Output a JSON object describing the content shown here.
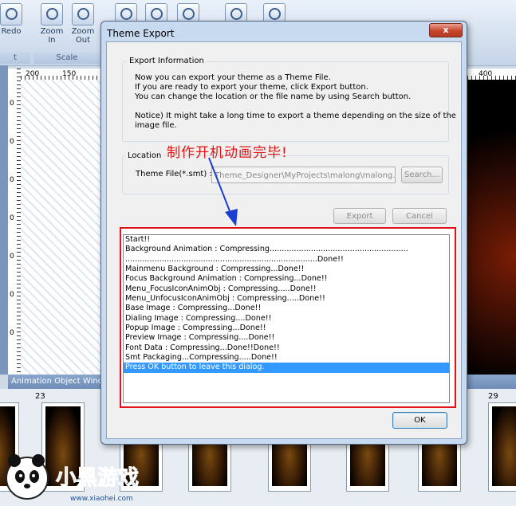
{
  "ribbon": {
    "redo_label": "Redo",
    "zoom_in_label": "Zoom\nIn",
    "zoom_out_label": "Zoom\nOut",
    "scale_group_label": "Scale",
    "edit_group_label": "t"
  },
  "rulers": {
    "h_left": [
      "200",
      "150"
    ],
    "h_right": "400",
    "v_labels": [
      "0",
      "0",
      "0",
      "0",
      "0",
      "0",
      "0"
    ]
  },
  "animation_window": {
    "title": "Animation Object Wind",
    "frame_numbers": [
      "23",
      "29"
    ]
  },
  "dialog": {
    "title": "Theme Export",
    "close_glyph": "x",
    "export_info": {
      "label": "Export Information",
      "lines": [
        "Now you can export your theme as a Theme File.",
        "If you are ready to export your theme, click Export button.",
        "You can change the location or the file name by using Search button.",
        "",
        "Notice) It might take a long time to export a theme depending on the size of the",
        "image file."
      ]
    },
    "location": {
      "label": "Location",
      "field_label": "Theme File(*.smt) :",
      "path_value": "Theme_Designer\\MyProjects\\malong\\malong.smt",
      "search_button": "Search..."
    },
    "export_button": "Export",
    "cancel_button": "Cancel",
    "ok_button": "OK",
    "log": [
      "Start!!",
      "Background Animation : Compressing.........................................................",
      "...............................................................................Done!!",
      "Mainmenu Background : Compressing...Done!!",
      "Focus Background Animation : Compressing...Done!!",
      "Menu_FocusIconAnimObj : Compressing.....Done!!",
      "Menu_UnfocusIconAnimObj : Compressing.....Done!!",
      "Base Image : Compressing...Done!!",
      "Dialing Image : Compressing....Done!!",
      "Popup Image : Compressing...Done!!",
      "Preview Image : Compressing....Done!!",
      "Font Data : Compressing...Done!!Done!!",
      "Smt Packaging...Compressing.....Done!!",
      "Press OK button to leave this dialog."
    ],
    "selected_index": 13
  },
  "annotation": {
    "text": "制作开机动画完毕!",
    "color": "#e01616"
  },
  "watermark": {
    "brand": "小黑游戏",
    "url": "www.xiaohei.com"
  }
}
